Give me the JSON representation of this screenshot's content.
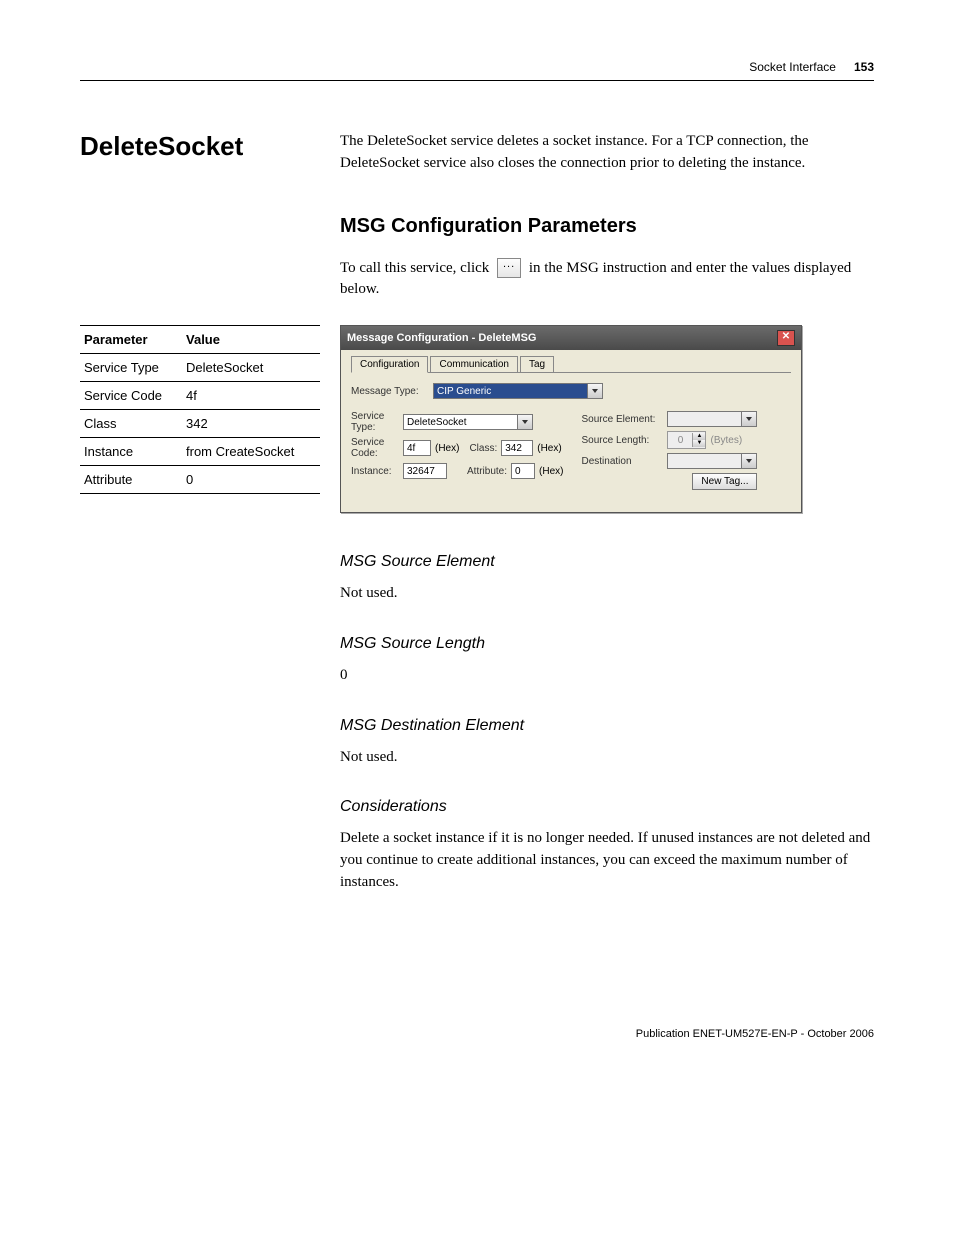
{
  "header": {
    "chapter": "Socket Interface",
    "pagenum": "153"
  },
  "section": {
    "title": "DeleteSocket",
    "intro": "The DeleteSocket service deletes a socket instance. For a TCP connection, the DeleteSocket service also closes the connection prior to deleting the instance."
  },
  "msg_params": {
    "heading": "MSG Configuration Parameters",
    "call_pre": "To call this service, click ",
    "call_post": " in the MSG instruction and enter the values displayed below."
  },
  "param_table": {
    "headers": [
      "Parameter",
      "Value"
    ],
    "rows": [
      [
        "Service Type",
        "DeleteSocket"
      ],
      [
        "Service Code",
        "4f"
      ],
      [
        "Class",
        "342"
      ],
      [
        "Instance",
        "from CreateSocket"
      ],
      [
        "Attribute",
        "0"
      ]
    ]
  },
  "dialog": {
    "title": "Message Configuration - DeleteMSG",
    "tabs": [
      "Configuration",
      "Communication",
      "Tag"
    ],
    "message_type_label": "Message Type:",
    "message_type_value": "CIP Generic",
    "service_type_label": "Service\nType:",
    "service_type_value": "DeleteSocket",
    "service_code_label": "Service\nCode:",
    "service_code_value": "4f",
    "hex": "(Hex)",
    "class_label": "Class:",
    "class_value": "342",
    "instance_label": "Instance:",
    "instance_value": "32647",
    "attribute_label": "Attribute:",
    "attribute_value": "0",
    "source_element_label": "Source Element:",
    "source_length_label": "Source Length:",
    "source_length_value": "0",
    "bytes": "(Bytes)",
    "destination_label": "Destination",
    "new_tag": "New Tag..."
  },
  "subs": {
    "src_elem_h": "MSG Source Element",
    "src_elem_v": "Not used.",
    "src_len_h": "MSG Source Length",
    "src_len_v": "0",
    "dest_h": "MSG Destination Element",
    "dest_v": "Not used.",
    "cons_h": "Considerations",
    "cons_v": "Delete a socket instance if it is no longer needed. If unused instances are not deleted and you continue to create additional instances, you can exceed the maximum number of instances."
  },
  "footer": "Publication ENET-UM527E-EN-P - October 2006"
}
